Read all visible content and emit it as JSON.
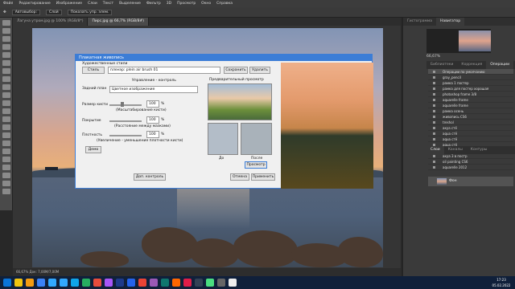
{
  "menubar": [
    "Файл",
    "Редактирование",
    "Изображение",
    "Слои",
    "Текст",
    "Выделение",
    "Фильтр",
    "3D",
    "Просмотр",
    "Окно",
    "Справка"
  ],
  "optbar": {
    "chip1": "Автовыбор:",
    "chip2": "Слой",
    "chip3": "Показать упр. элем."
  },
  "tabs": [
    {
      "label": "Лагуна утром.jpg @ 100% (RGB/8*)",
      "active": false
    },
    {
      "label": "Пирс.jpg @ 66,7% (RGB/8#)",
      "active": true
    }
  ],
  "status": "66,67%   Док: 7,00M/7,00M",
  "right_panel": {
    "tabs1": [
      "Гистограмма",
      "Навигатор"
    ],
    "zoom": "66,67%",
    "tabs2": [
      "Библиотеки",
      "Коррекция",
      "Операции"
    ],
    "history_items": [
      "Операции по умолчанию",
      "gray_pencil",
      "рамка 1 постер",
      "рамка для постер хорошая",
      "photoshop frame 3/8",
      "aquarelle frame",
      "aquarelle frame",
      "рамка осень",
      "живопись CS6",
      "treshol",
      "акуа стё",
      "aqua стё",
      "aqua стё",
      "aqua стё",
      "aquarelle frame",
      "акуа 3 в постр",
      "oil painting CS6",
      "aquarelle 2012"
    ],
    "layers_tabs": [
      "Слои",
      "Каналы",
      "Контуры"
    ],
    "layer_name": "Фон"
  },
  "dialog": {
    "title": "Плакатная живопись",
    "artistic_styles": "Художественные стили",
    "style_btn": "Стиль",
    "preset_value": "пленэр: plein air brush 01",
    "save": "Сохранить",
    "delete": "Удалить",
    "section_control": "Управление - контроль",
    "background_label": "Задний план",
    "background_value": "Цветное изображение",
    "brush_size_label": "Размер кисти",
    "brush_size_value": "100",
    "brush_unit": "%",
    "brush_hint": "(Масштабирование кисти)",
    "coverage_label": "Покрытие",
    "coverage_value": "100",
    "coverage_hint": "(Расстояние между мазками)",
    "density_label": "Плотность",
    "density_value": "100",
    "density_hint": "(Увеличение - уменьшение плотности кисти)",
    "demo": "Демо",
    "extra": "Доп. контроль",
    "preview_label": "Предварительный просмотр",
    "before": "До",
    "after": "После",
    "preview_btn": "Просмотр",
    "cancel": "Отмена",
    "apply": "Применить"
  },
  "clock": {
    "time": "17:23",
    "date": "05.02.2022"
  },
  "colors": {
    "accent": "#3c7dd6",
    "taskbar": "#10203a"
  }
}
